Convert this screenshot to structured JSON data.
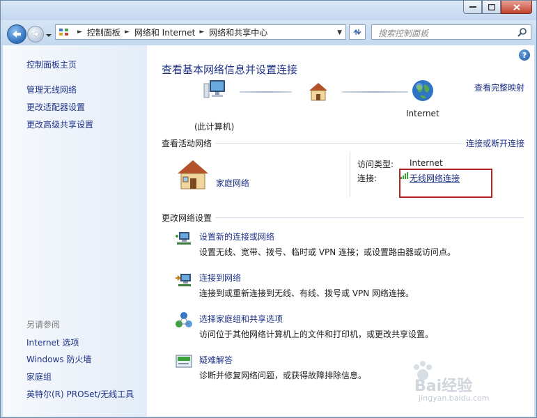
{
  "address_bar": {
    "breadcrumbs": [
      "控制面板",
      "网络和 Internet",
      "网络和共享中心"
    ],
    "search_placeholder": "搜索控制面板"
  },
  "sidebar": {
    "top_links": [
      "控制面板主页",
      "管理无线网络",
      "更改适配器设置",
      "更改高级共享设置"
    ],
    "see_also_heading": "另请参阅",
    "see_also_links": [
      "Internet 选项",
      "Windows 防火墙",
      "家庭组",
      "英特尔(R) PROSet/无线工具"
    ]
  },
  "main": {
    "help_label": "?",
    "title": "查看基本网络信息并设置连接",
    "full_map_link": "查看完整映射",
    "map": {
      "computer_label": "(此计算机)",
      "internet_label": "Internet"
    },
    "active_networks": {
      "heading": "查看活动网络",
      "connect_link": "连接或断开连接",
      "network_name": "家庭网络",
      "access_type_label": "访问类型:",
      "access_type_value": "Internet",
      "connection_label": "连接:",
      "connection_value": "无线网络连接"
    },
    "change_settings": {
      "heading": "更改网络设置",
      "tasks": [
        {
          "link": "设置新的连接或网络",
          "desc": "设置无线、宽带、拨号、临时或 VPN 连接；或设置路由器或访问点。",
          "icon": "network-setup-icon"
        },
        {
          "link": "连接到网络",
          "desc": "连接到或重新连接到无线、有线、拨号或 VPN 网络连接。",
          "icon": "connect-network-icon"
        },
        {
          "link": "选择家庭组和共享选项",
          "desc": "访问位于其他网络计算机上的文件和打印机，或更改共享设置。",
          "icon": "homegroup-icon"
        },
        {
          "link": "疑难解答",
          "desc": "诊断并修复网络问题，或获得故障排除信息。",
          "icon": "troubleshoot-icon"
        }
      ]
    }
  },
  "watermark": {
    "brand": "Bai经验",
    "url": "jingyan.baidu.com"
  },
  "colors": {
    "link": "#1e3287",
    "highlight_box": "#b52325",
    "sidebar_bg": "#e3ecf8"
  }
}
